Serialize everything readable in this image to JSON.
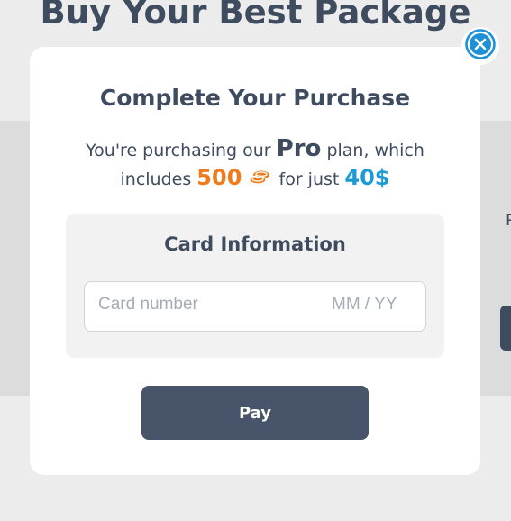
{
  "background": {
    "title": "Buy Your Best Package",
    "edge_text": "P"
  },
  "modal": {
    "title": "Complete Your Purchase",
    "purchase": {
      "prefix": "You're purchasing our",
      "plan": "Pro",
      "plan_suffix": "plan, which",
      "includes": "includes",
      "amount": "500",
      "coin_icon": "coins-icon",
      "for_just": "for just",
      "price": "40$"
    },
    "card": {
      "title": "Card Information",
      "number_placeholder": "Card number",
      "expiry_placeholder": "MM / YY"
    },
    "pay_label": "Pay",
    "close_icon": "close-icon"
  },
  "colors": {
    "accent_orange": "#f07b1c",
    "accent_blue": "#1b9ad6",
    "primary_dark": "#47546a",
    "close_blue": "#1e90d8"
  }
}
